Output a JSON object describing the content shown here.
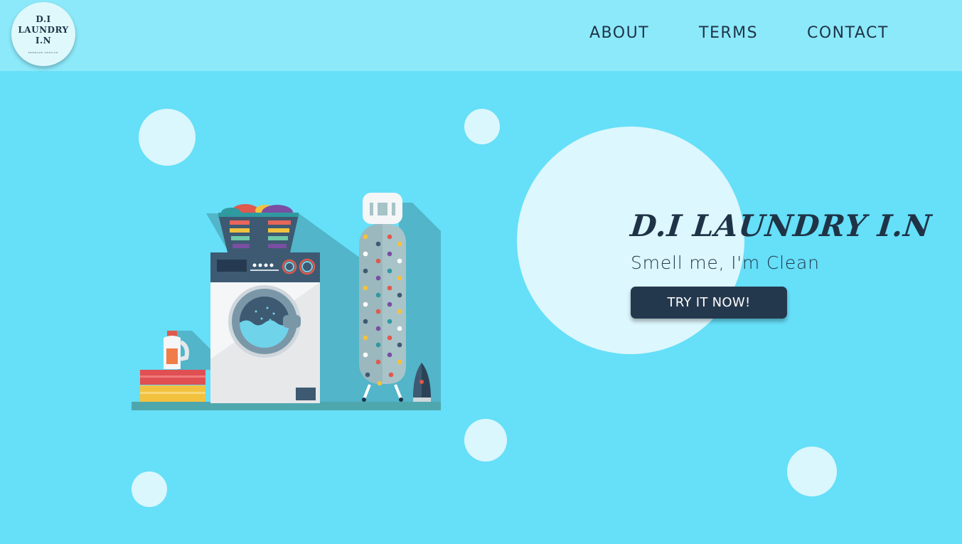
{
  "header": {
    "logo": {
      "line1": "D.I",
      "line2": "LAUNDRY",
      "line3": "I.N",
      "subtitle": "PREMIUM SERVICE",
      "icon": "laundry-logo"
    },
    "nav": [
      {
        "label": "ABOUT"
      },
      {
        "label": "TERMS"
      },
      {
        "label": "CONTACT"
      }
    ]
  },
  "hero": {
    "brand": "D.I LAUNDRY I.N",
    "tagline": "Smell me, I'm Clean",
    "cta_label": "TRY IT NOW!",
    "illustration": "laundry-room-illustration"
  },
  "colors": {
    "background": "#66dff8",
    "navbar": "#8ce9fa",
    "bubble": "#daf7fd",
    "primary_dark": "#24384d"
  }
}
